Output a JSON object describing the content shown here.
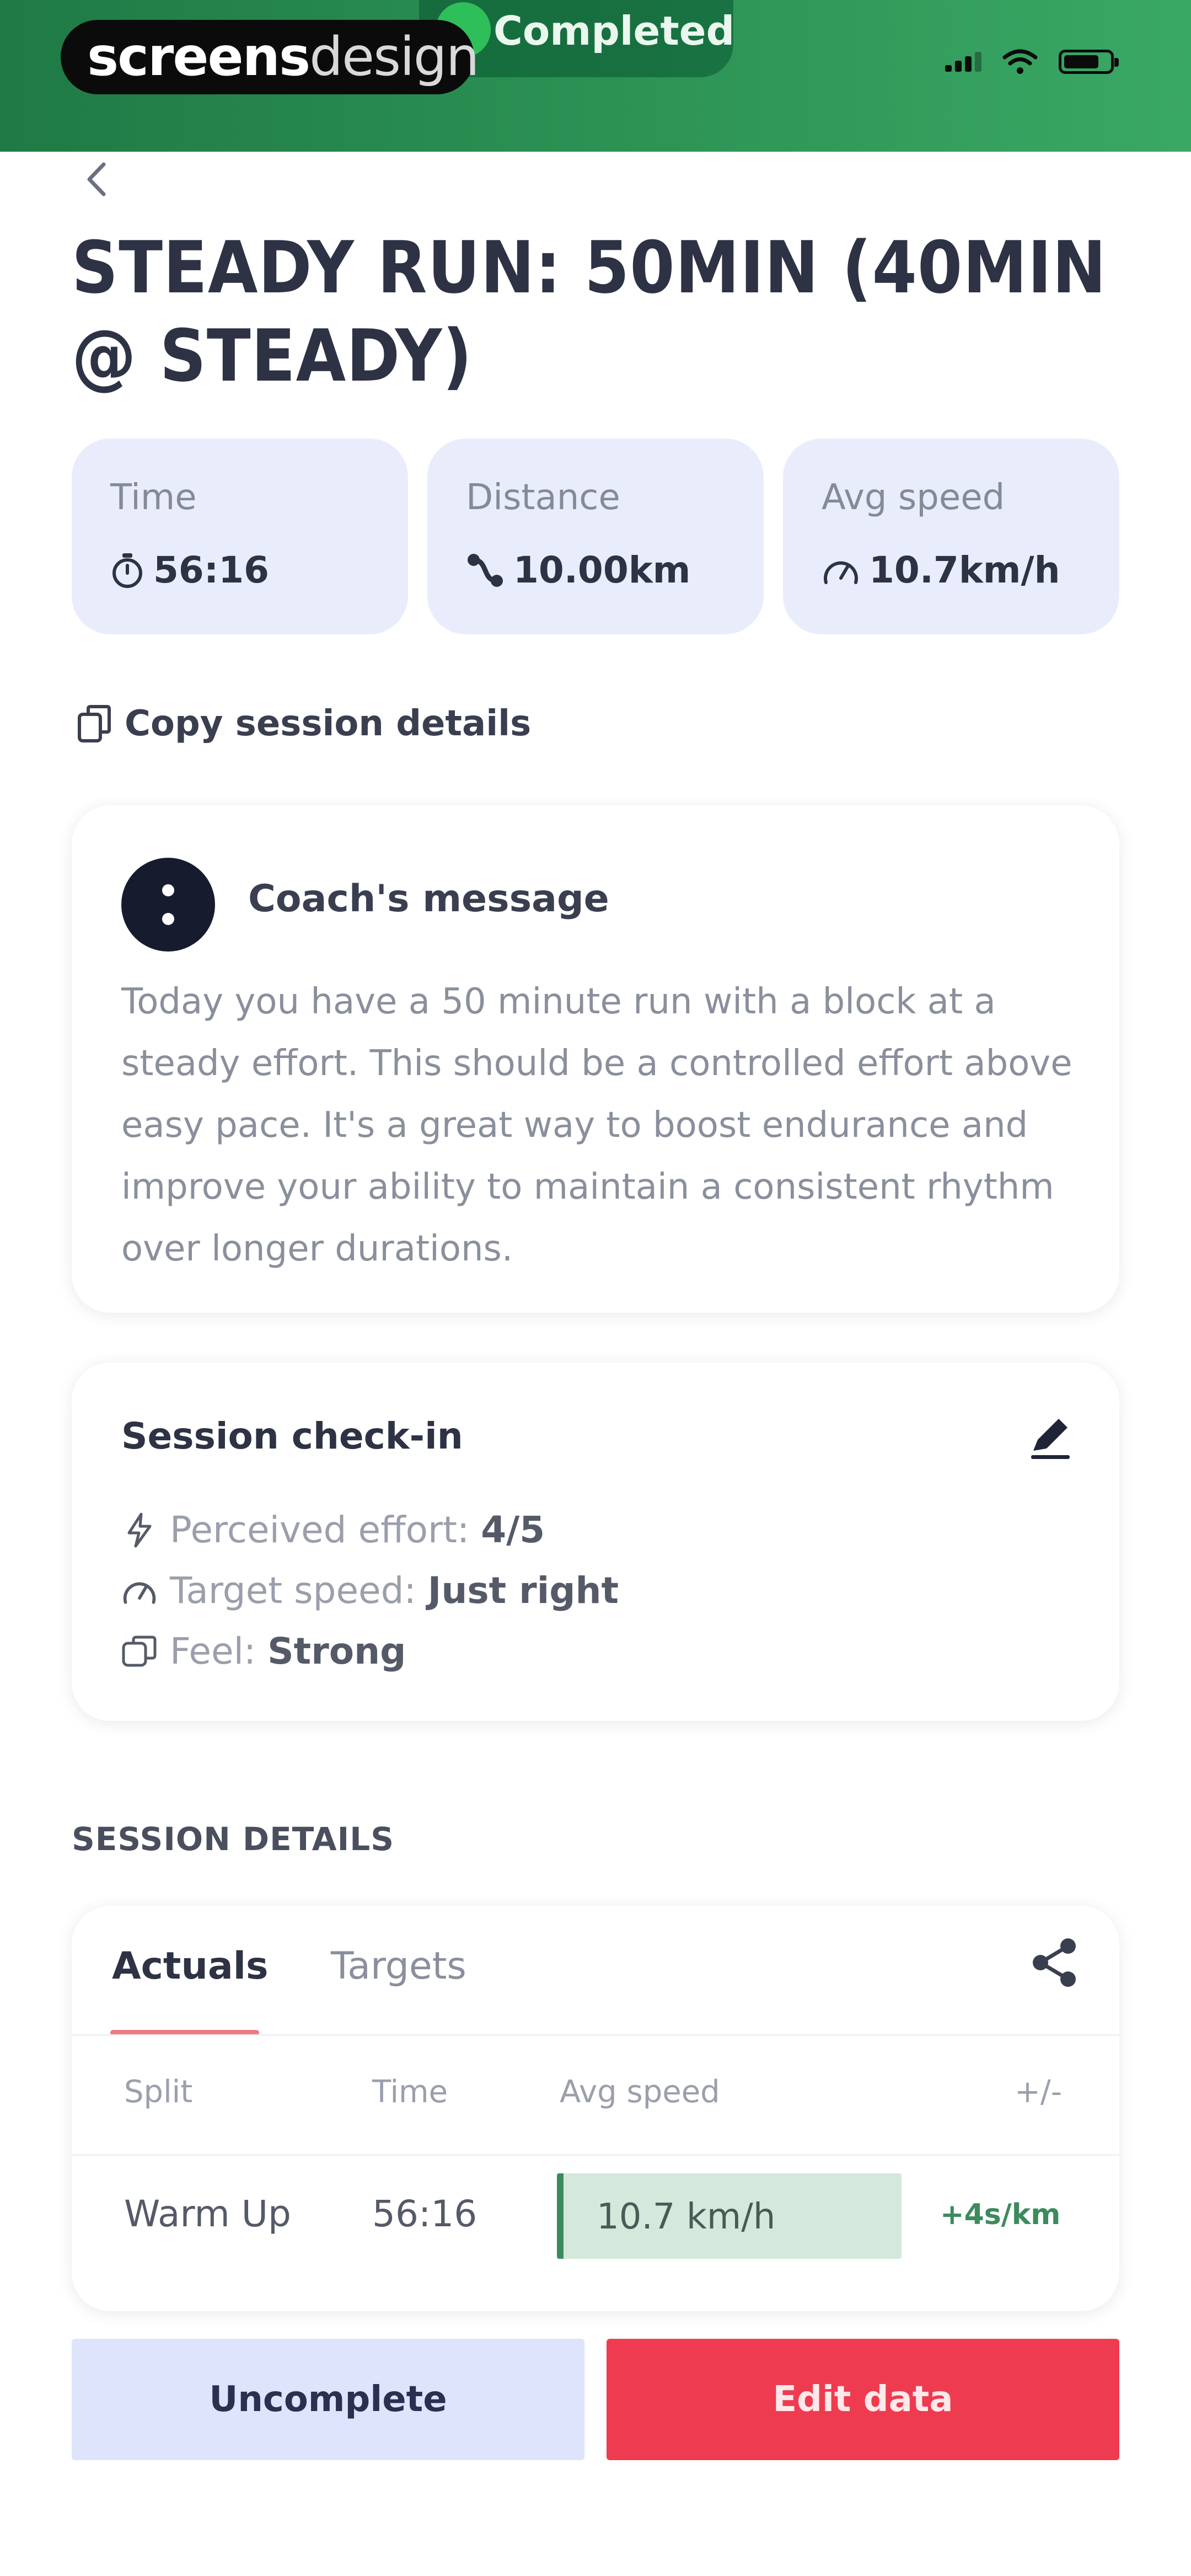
{
  "status_bar": {
    "watermark_brand": "screens",
    "watermark_brand_suffix": "design",
    "session_status": "Completed"
  },
  "header": {
    "back_icon": "chevron-left-icon",
    "title": "STEADY RUN: 50MIN (40MIN @ STEADY)"
  },
  "stats": [
    {
      "label": "Time",
      "value": "56:16",
      "icon": "stopwatch-icon"
    },
    {
      "label": "Distance",
      "value": "10.00km",
      "icon": "route-icon"
    },
    {
      "label": "Avg speed",
      "value": "10.7km/h",
      "icon": "speedometer-icon"
    }
  ],
  "copy_action": {
    "label": "Copy session details",
    "icon": "copy-icon"
  },
  "coach": {
    "title": "Coach's message",
    "message": "Today you have a 50 minute run with a block at a steady effort. This should be a controlled effort above easy pace. It's a great way to boost endurance and improve your ability to maintain a consistent rhythm over longer durations."
  },
  "checkin": {
    "title": "Session check-in",
    "items": [
      {
        "label": "Perceived effort:",
        "value": "4/5",
        "icon": "effort-icon"
      },
      {
        "label": "Target speed:",
        "value": "Just right",
        "icon": "speedometer-icon"
      },
      {
        "label": "Feel:",
        "value": "Strong",
        "icon": "feel-icon"
      }
    ]
  },
  "session_details": {
    "section_label": "SESSION DETAILS",
    "tabs": [
      "Actuals",
      "Targets"
    ],
    "active_tab": "Actuals",
    "columns": [
      "Split",
      "Time",
      "Avg speed",
      "+/-"
    ],
    "rows": [
      {
        "split": "Warm Up",
        "time": "56:16",
        "avg_speed": "10.7 km/h",
        "diff": "+4s/km"
      }
    ]
  },
  "actions": {
    "secondary": "Uncomplete",
    "primary": "Edit data"
  },
  "colors": {
    "header_green": "#2a8f52",
    "stat_card_bg": "#e9edfb",
    "primary_red": "#ee3b50",
    "secondary_blue": "#dde4fb",
    "positive_green": "#3d8b5d"
  }
}
